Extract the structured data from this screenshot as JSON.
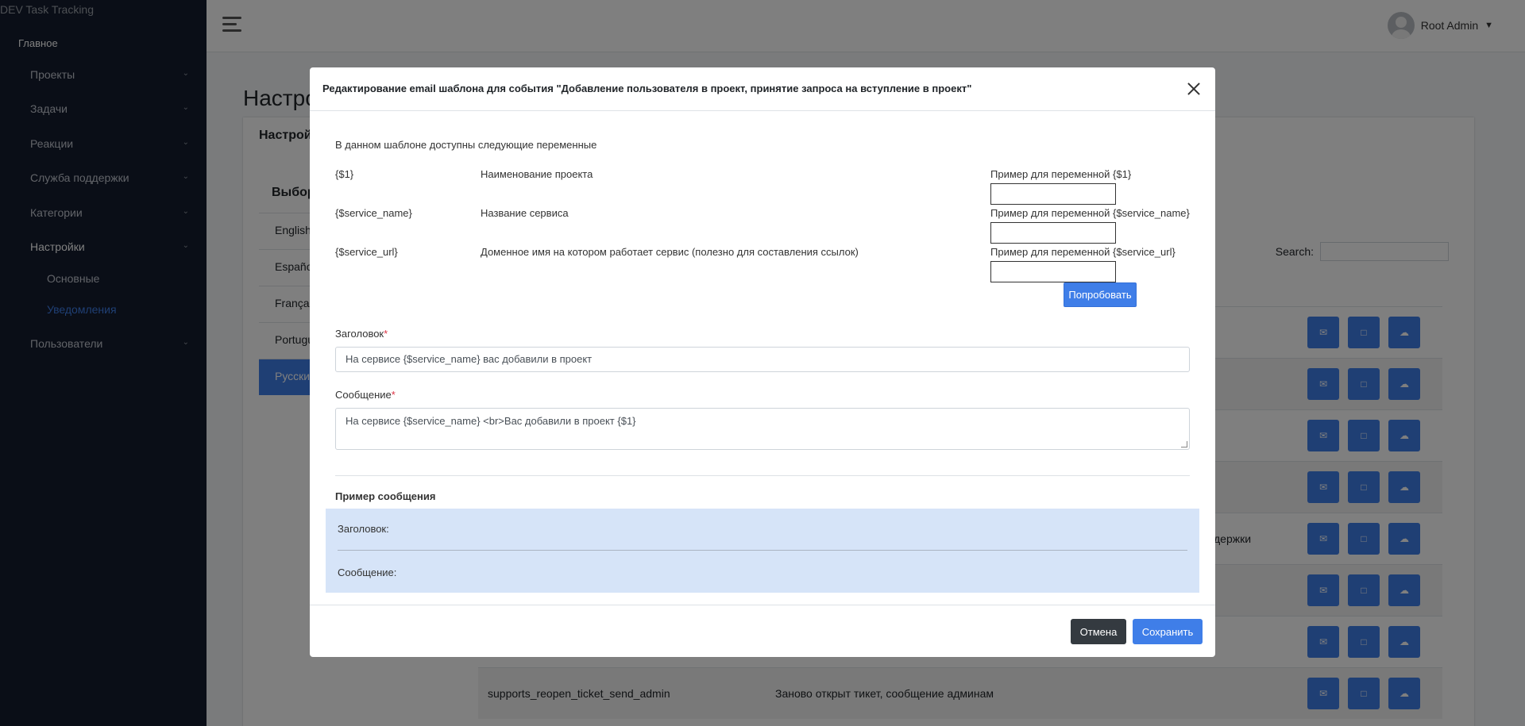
{
  "app": {
    "brand": "DEV Task Tracking"
  },
  "sidebar": {
    "main_label": "Главное",
    "items": [
      {
        "label": "Проекты",
        "has_children": true
      },
      {
        "label": "Задачи",
        "has_children": true
      },
      {
        "label": "Реакции",
        "has_children": true
      },
      {
        "label": "Служба поддержки",
        "has_children": true
      },
      {
        "label": "Категории",
        "has_children": true
      },
      {
        "label": "Настройки",
        "has_children": true,
        "expanded": true
      },
      {
        "label": "Пользователи",
        "has_children": true
      }
    ],
    "settings_subitems": [
      {
        "label": "Основные"
      },
      {
        "label": "Уведомления",
        "active": true
      }
    ]
  },
  "header": {
    "user_name": "Root Admin"
  },
  "page": {
    "title": "Настро",
    "card_title": "Настройк",
    "languages_title": "Выбор",
    "languages": [
      "English",
      "Españo",
      "Françai",
      "Portugu",
      "Русский"
    ],
    "search_label": "Search:",
    "rows": [
      {
        "key": "",
        "description": ""
      },
      {
        "key": "",
        "description": ""
      },
      {
        "key": "",
        "description": ""
      },
      {
        "key": "",
        "description": ""
      },
      {
        "key": "",
        "description": "держки"
      },
      {
        "key": "",
        "description": ""
      },
      {
        "key": "",
        "description": ""
      },
      {
        "key": "supports_reopen_ticket_send_admin",
        "description": "Заново открыт тикет, сообщение админам"
      }
    ]
  },
  "modal": {
    "title": "Редактирование email шаблона для события \"Добавление пользователя в проект, принятие запроса на вступление в проект\"",
    "intro": "В данном шаблоне доступны следующие переменные",
    "variables": [
      {
        "name": "{$1}",
        "description": "Наименование проекта",
        "example_label": "Пример для переменной {$1}",
        "example_value": ""
      },
      {
        "name": "{$service_name}",
        "description": "Название сервиса",
        "example_label": "Пример для переменной {$service_name}",
        "example_value": ""
      },
      {
        "name": "{$service_url}",
        "description": "Доменное имя на котором работает сервис (полезно для составления ссылок)",
        "example_label": "Пример для переменной {$service_url}",
        "example_value": ""
      }
    ],
    "try_button": "Попробовать",
    "subject_label": "Заголовок",
    "subject_value": "На сервисе {$service_name} вас добавили в проект",
    "message_label": "Сообщение",
    "message_value": "На сервисе {$service_name} <br>Вас добавили в проект {$1}",
    "example_title": "Пример сообщения",
    "example_subject_label": "Заголовок:",
    "example_message_label": "Сообщение:",
    "cancel_button": "Отмена",
    "save_button": "Сохранить"
  },
  "colors": {
    "primary": "#3f7ee8",
    "sidebar_bg": "#141c2e",
    "example_bg": "#d6e4f8",
    "dark_button": "#343a40"
  }
}
